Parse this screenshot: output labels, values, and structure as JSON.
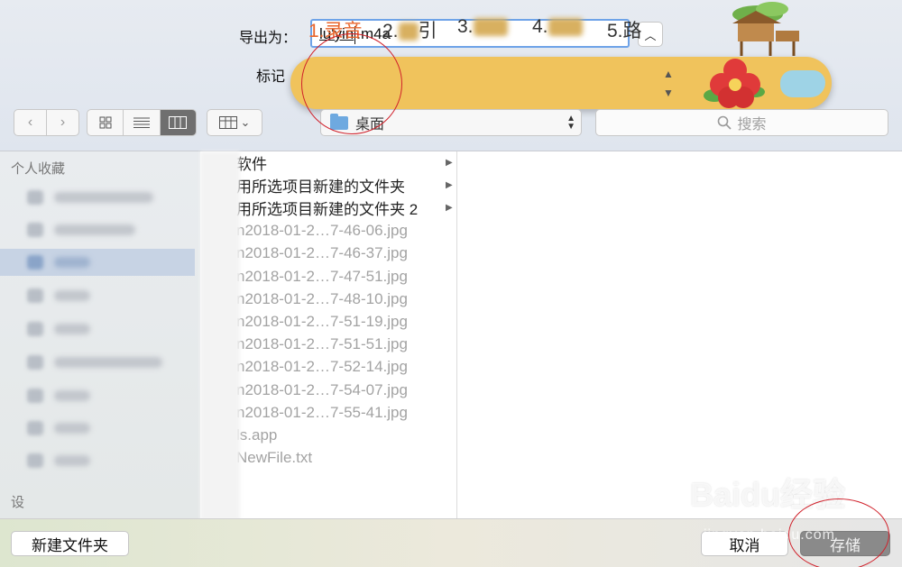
{
  "header": {
    "export_label": "导出为：",
    "filename_before_caret": "lu'yin",
    "filename_after_caret": ".m4a",
    "tag_label": "标记"
  },
  "ime": {
    "candidates": [
      {
        "text": "1.录音",
        "active": true
      },
      {
        "text": "2.",
        "suffix": "引",
        "blurred": true
      },
      {
        "text": "3.",
        "blurred": true
      },
      {
        "text": "4.",
        "blurred": true
      },
      {
        "text": "5.路"
      }
    ],
    "up_arrow": "▲",
    "down_arrow": "▼"
  },
  "toolbar": {
    "back": "‹",
    "forward": "›",
    "location": "桌面",
    "search_placeholder": "搜索"
  },
  "sidebar": {
    "favorites_header": "个人收藏",
    "devices_header": "设"
  },
  "files": [
    {
      "name": "软件",
      "color": "#e2524a",
      "folder": true,
      "dim": false
    },
    {
      "name": "用所选项目新建的文件夹",
      "color": "#8cc6ee",
      "folder": true,
      "dim": false
    },
    {
      "name": "用所选项目新建的文件夹 2",
      "color": "#8cc6ee",
      "folder": true,
      "dim": false
    },
    {
      "name": "n2018-01-2…7-46-06.jpg",
      "dim": true
    },
    {
      "name": "n2018-01-2…7-46-37.jpg",
      "dim": true
    },
    {
      "name": "n2018-01-2…7-47-51.jpg",
      "dim": true
    },
    {
      "name": "n2018-01-2…7-48-10.jpg",
      "dim": true
    },
    {
      "name": "n2018-01-2…7-51-19.jpg",
      "dim": true
    },
    {
      "name": "n2018-01-2…7-51-51.jpg",
      "dim": true
    },
    {
      "name": "n2018-01-2…7-52-14.jpg",
      "dim": true
    },
    {
      "name": "n2018-01-2…7-54-07.jpg",
      "dim": true
    },
    {
      "name": "n2018-01-2…7-55-41.jpg",
      "dim": true
    },
    {
      "name": "ls.app",
      "dim": true
    },
    {
      "name": "NewFile.txt",
      "dim": true
    }
  ],
  "footer": {
    "new_folder": "新建文件夹",
    "cancel": "取消",
    "save": "存储"
  },
  "watermark": {
    "brand": "Baidu经验",
    "url": "jingyan.baidu.com"
  },
  "colors": {
    "ime_bar": "#f0c35c",
    "ime_active": "#e8662e",
    "annotation_circle": "#d0202a",
    "selection": "#c7d3e4"
  }
}
